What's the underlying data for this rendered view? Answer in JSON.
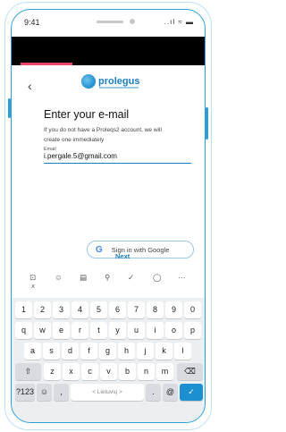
{
  "status_bar": {
    "time": "9:41",
    "icons": "..ıl ≈ ▬"
  },
  "header": {
    "back_icon": "‹",
    "logo_text": "prolegus"
  },
  "signin": {
    "title": "Enter your e-mail",
    "description": "If you do not have a Proleqs2 account, we will create one immediately",
    "email_label": "Email",
    "email_value": "i.pergale.5@gmail.com",
    "google_button": "Sign in with Google",
    "next": "Next"
  },
  "keyboard": {
    "toolbar": [
      "⊡",
      "☺",
      "▤",
      "⚲",
      "✓",
      "◯",
      "···"
    ],
    "collapse": "ⅹ",
    "row1": [
      "1",
      "2",
      "3",
      "4",
      "5",
      "6",
      "7",
      "8",
      "9",
      "0"
    ],
    "row2": [
      "q",
      "w",
      "e",
      "r",
      "t",
      "y",
      "u",
      "i",
      "o",
      "p"
    ],
    "row3": [
      "a",
      "s",
      "d",
      "f",
      "g",
      "h",
      "j",
      "k",
      "l"
    ],
    "row4": [
      "z",
      "x",
      "c",
      "v",
      "b",
      "n",
      "m"
    ],
    "shift": "⇧",
    "backspace": "⌫",
    "symbols": "?123",
    "emoji": "☺",
    "comma": ",",
    "space": "< Lietuvių >",
    "period": ".",
    "at": "@",
    "enter": "✓"
  }
}
